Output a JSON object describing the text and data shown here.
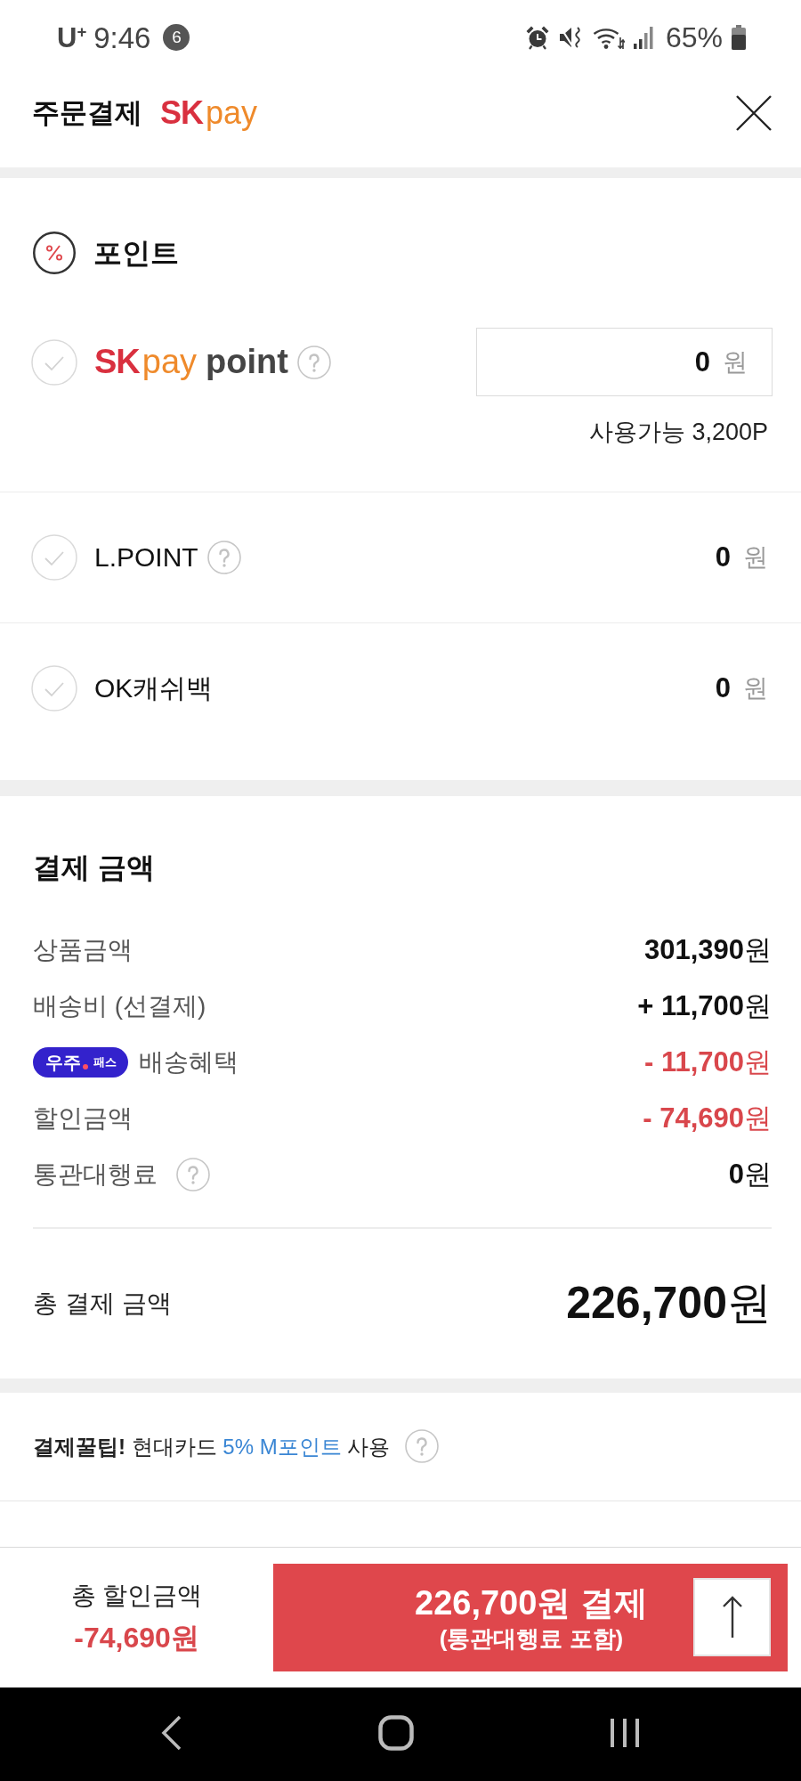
{
  "status_bar": {
    "carrier": "U$^{+}$",
    "time": "9:46",
    "notification_count": "6",
    "battery": "65%"
  },
  "header": {
    "title": "주문결제",
    "logo": {
      "brand": "SK",
      "product": "pay"
    }
  },
  "points": {
    "title": "포인트",
    "items": [
      {
        "kind": "input",
        "logo": {
          "brand": "SK",
          "product": "pay",
          "suffix": "point"
        },
        "help": true,
        "checked": false,
        "value": "0",
        "unit": "원",
        "available": "사용가능 3,200P"
      },
      {
        "kind": "plain",
        "label": "L.POINT",
        "help": true,
        "checked": false,
        "value": "0",
        "unit": "원"
      },
      {
        "kind": "plain",
        "label": "OK캐쉬백",
        "checked": false,
        "value": "0",
        "unit": "원"
      }
    ]
  },
  "payment": {
    "title": "결제 금액",
    "rows": [
      {
        "kind": "normal",
        "label": "상품금액",
        "amount": "**301,390**원"
      },
      {
        "kind": "normal",
        "label": "배송비 (선결제)",
        "amount": "**+ 11,700**원"
      },
      {
        "kind": "discount",
        "badge": {
          "brand": "우주",
          "label": "패스"
        },
        "label": "배송혜택",
        "amount": "**- 11,700**원"
      },
      {
        "kind": "discount",
        "label": "할인금액",
        "amount": "**- 74,690**원"
      },
      {
        "kind": "normal",
        "label": "통관대행료",
        "help": true,
        "amount": "**0**원"
      }
    ],
    "total": {
      "label": "총 결제 금액",
      "amount": "**226,700**원"
    }
  },
  "tip": {
    "before": "**결제꿀팁!** 현대카드",
    "link": "5% M포인트",
    "after": "사용",
    "help": true
  },
  "bottom_bar": {
    "discount_label": "총 할인금액",
    "discount_amount": "-74,690원",
    "pay_button": {
      "title": "226,700원 결제",
      "subtitle": "(통관대행료 포함)"
    }
  }
}
